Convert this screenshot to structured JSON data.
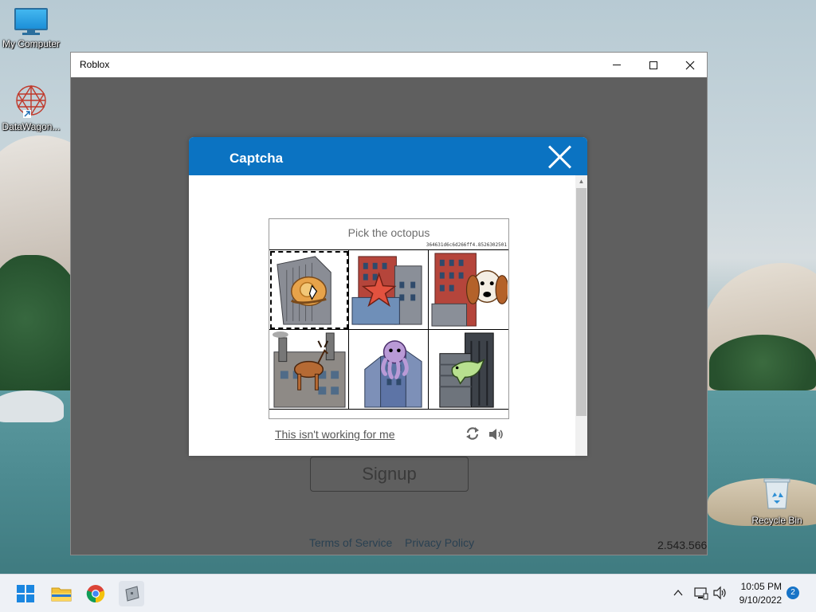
{
  "desktop": {
    "icons": [
      {
        "label": "My Computer"
      },
      {
        "label": "DataWagon..."
      },
      {
        "label": "Recycle Bin"
      }
    ]
  },
  "window": {
    "title": "Roblox",
    "signup_label": "Signup",
    "footer": {
      "terms": "Terms of Service",
      "privacy": "Privacy Policy"
    },
    "version": "2.543.566"
  },
  "captcha": {
    "title": "Captcha",
    "prompt": "Pick the octopus",
    "puzzle_id": "364631d6c6d266ff4.8526302501",
    "help_link": "This isn't working for me",
    "tiles": [
      {
        "animal": "snail"
      },
      {
        "animal": "starfish"
      },
      {
        "animal": "dog"
      },
      {
        "animal": "deer"
      },
      {
        "animal": "octopus"
      },
      {
        "animal": "dinosaur"
      }
    ]
  },
  "taskbar": {
    "time": "10:05 PM",
    "date": "9/10/2022",
    "notification_count": "2"
  }
}
